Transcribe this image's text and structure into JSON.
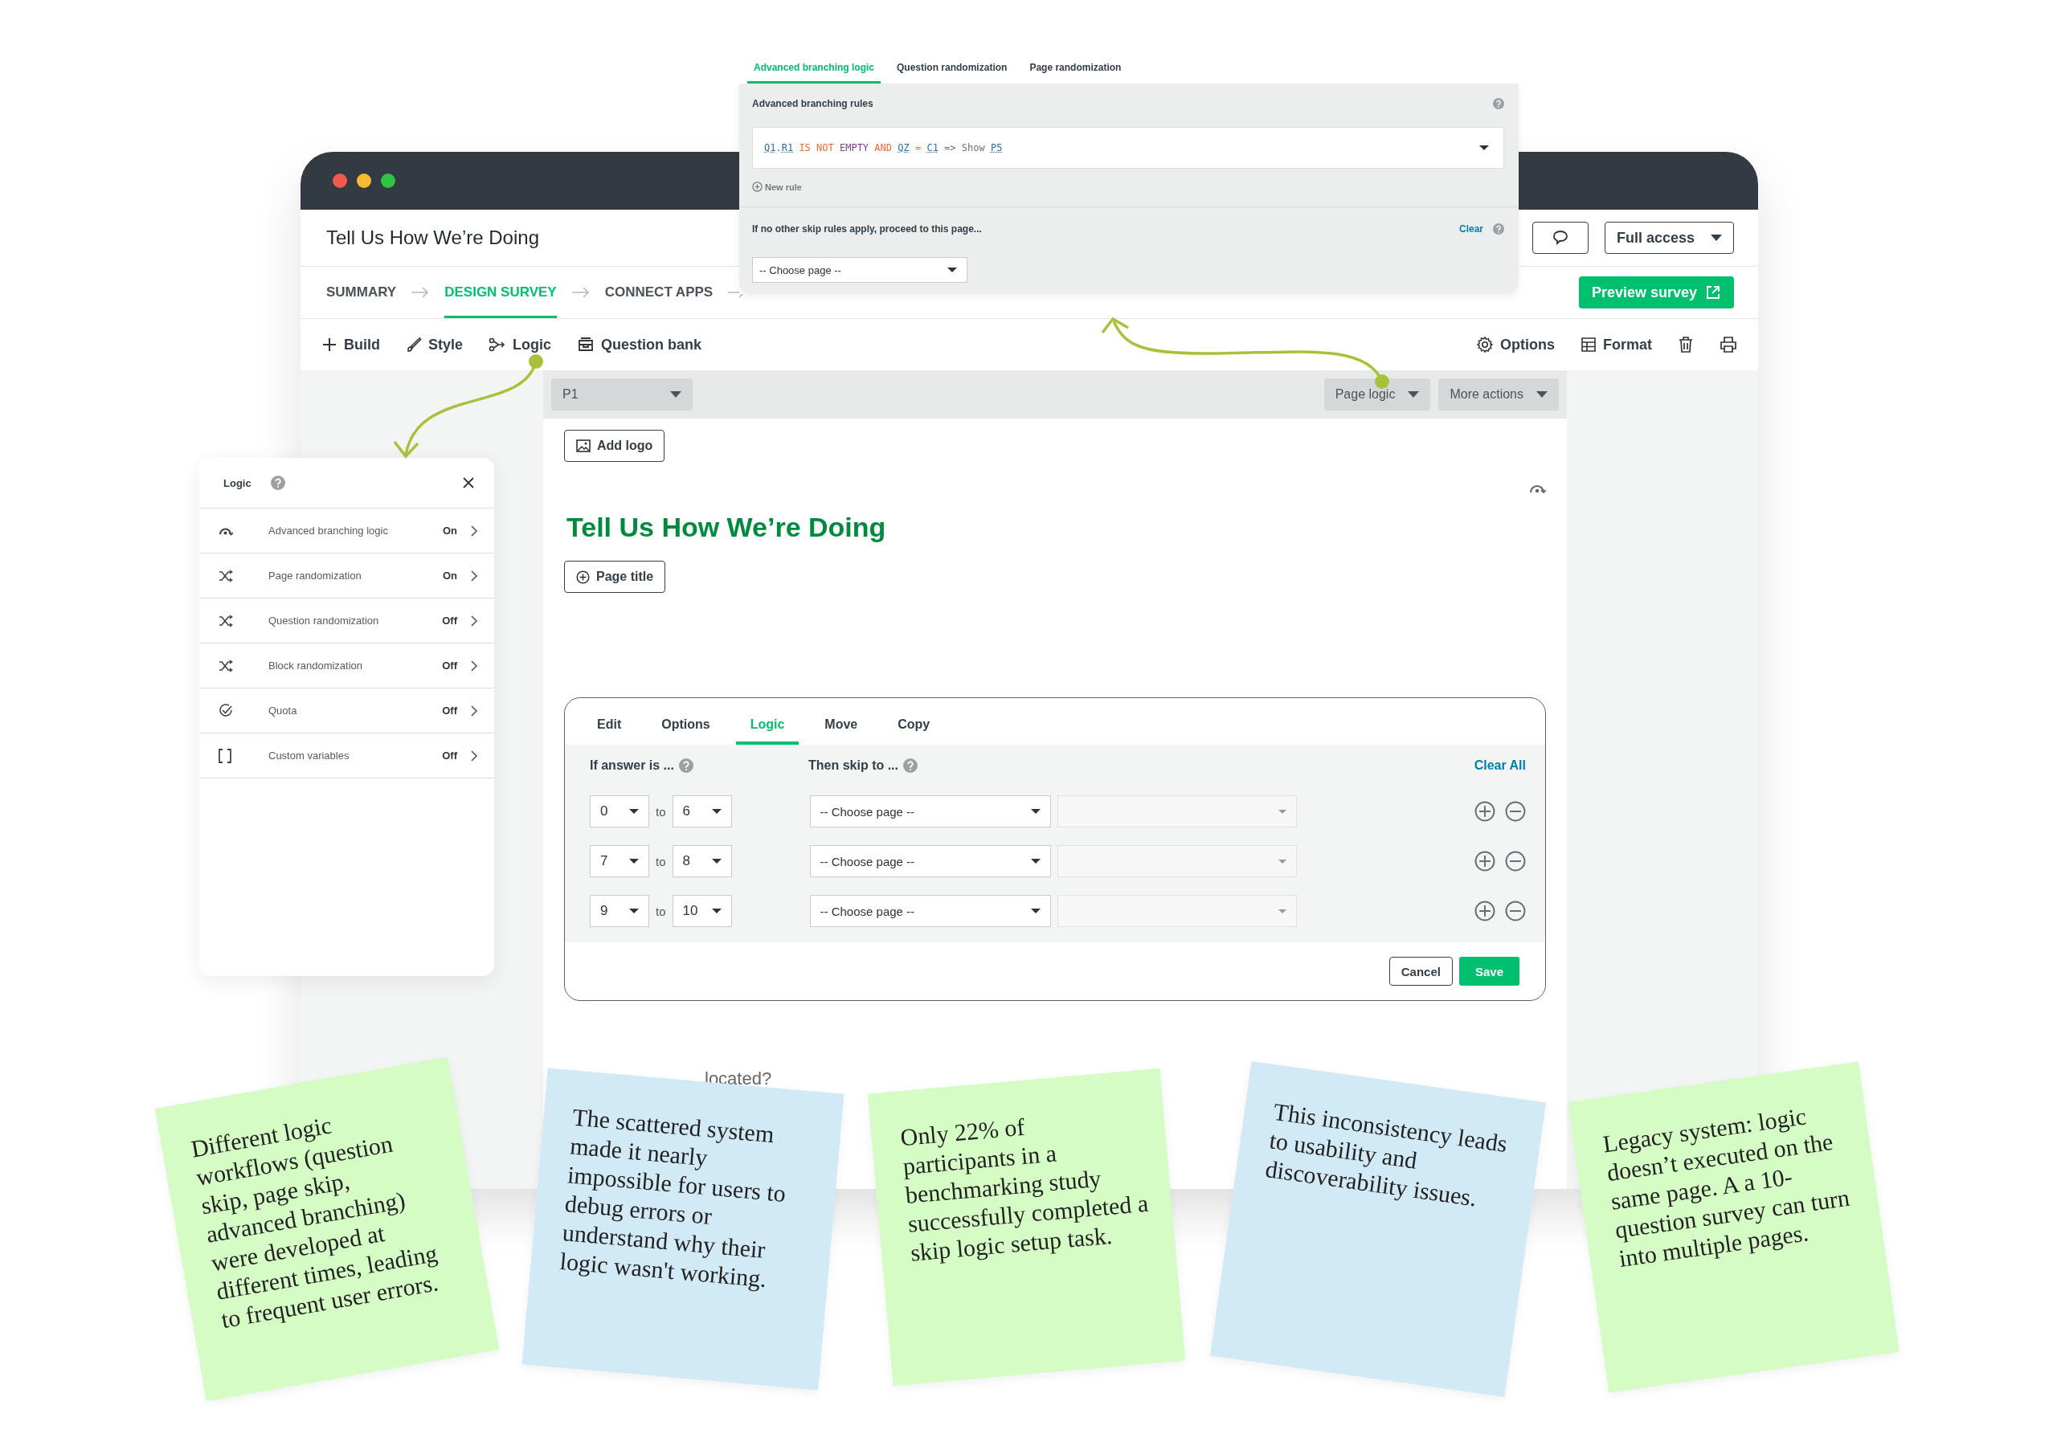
{
  "window": {
    "title": "Tell Us How We’re Doing",
    "access_button": "Full access"
  },
  "nav": [
    {
      "label": "SUMMARY",
      "selected": false
    },
    {
      "label": "DESIGN SURVEY",
      "selected": true
    },
    {
      "label": "CONNECT APPS",
      "selected": false
    }
  ],
  "preview_button": "Preview survey",
  "toolbar_left": [
    {
      "label": "Build",
      "kind": "plus"
    },
    {
      "label": "Style",
      "kind": "brush"
    },
    {
      "label": "Logic",
      "kind": "branch"
    },
    {
      "label": "Question bank",
      "kind": "bank"
    }
  ],
  "toolbar_right": [
    {
      "label": "Options",
      "kind": "gear"
    },
    {
      "label": "Format",
      "kind": "grid"
    }
  ],
  "page": {
    "page_select": "P1",
    "page_logic": "Page logic",
    "more_actions": "More actions",
    "add_logo": "Add logo",
    "survey_title": "Tell Us How We’re Doing",
    "page_title_button": "Page title",
    "question_fragment": "located?"
  },
  "question_editor": {
    "tabs": [
      {
        "label": "Edit",
        "selected": false
      },
      {
        "label": "Options",
        "selected": false
      },
      {
        "label": "Logic",
        "selected": true
      },
      {
        "label": "Move",
        "selected": false
      },
      {
        "label": "Copy",
        "selected": false
      }
    ],
    "if_label": "If answer is ...",
    "then_label": "Then skip to ...",
    "clear_all": "Clear All",
    "rules": [
      {
        "from": "0",
        "connector": "to",
        "to": "6",
        "page": "-- Choose page --"
      },
      {
        "from": "7",
        "connector": "to",
        "to": "8",
        "page": "-- Choose page --"
      },
      {
        "from": "9",
        "connector": "to",
        "to": "10",
        "page": "-- Choose page --"
      }
    ],
    "cancel": "Cancel",
    "save": "Save"
  },
  "branching_popup": {
    "tabs": [
      {
        "label": "Advanced branching logic",
        "selected": true
      },
      {
        "label": "Question randomization",
        "selected": false
      },
      {
        "label": "Page randomization",
        "selected": false
      }
    ],
    "rules_title": "Advanced branching rules",
    "rule": [
      {
        "text": "Q1",
        "kind": "ref"
      },
      {
        "text": ".",
        "kind": "plain"
      },
      {
        "text": "R1",
        "kind": "ref"
      },
      {
        "text": "IS NOT",
        "kind": "keyword"
      },
      {
        "text": "EMPTY",
        "kind": "value"
      },
      {
        "text": "AND",
        "kind": "keyword"
      },
      {
        "text": "QZ",
        "kind": "ref"
      },
      {
        "text": "=",
        "kind": "keyword"
      },
      {
        "text": "C1",
        "kind": "ref"
      },
      {
        "text": "=>",
        "kind": "plain"
      },
      {
        "text": "Show",
        "kind": "plain"
      },
      {
        "text": "P5",
        "kind": "ref"
      }
    ],
    "new_rule": "New rule",
    "fallback_label": "If no other skip rules apply, proceed to this page...",
    "clear": "Clear",
    "page_select": "-- Choose page --"
  },
  "logic_panel": {
    "title": "Logic",
    "items": [
      {
        "label": "Advanced branching logic",
        "status": "On",
        "kind": "branch"
      },
      {
        "label": "Page randomization",
        "status": "On",
        "kind": "shuffle"
      },
      {
        "label": "Question randomization",
        "status": "Off",
        "kind": "shuffle"
      },
      {
        "label": "Block randomization",
        "status": "Off",
        "kind": "shuffle"
      },
      {
        "label": "Quota",
        "status": "Off",
        "kind": "check"
      },
      {
        "label": "Custom variables",
        "status": "Off",
        "kind": "brackets"
      }
    ]
  },
  "notes": [
    {
      "text": "Different logic workflows (question skip, page skip, advanced branching) were developed at different times, leading to frequent user errors.",
      "color": "#d6fcc6"
    },
    {
      "text": "The scattered system made it nearly impossible for users to debug errors or understand why their logic wasn't working.",
      "color": "#d2eaf6"
    },
    {
      "text": "Only 22% of participants in a benchmarking study successfully completed a skip logic setup task.",
      "color": "#d6fcc6"
    },
    {
      "text": "This inconsistency leads to usability and discoverability issues.",
      "color": "#d2eaf6"
    },
    {
      "text": "Legacy system: logic doesn’t executed on the same page. A a 10-question survey can turn into multiple pages.",
      "color": "#d6fcc6"
    }
  ]
}
